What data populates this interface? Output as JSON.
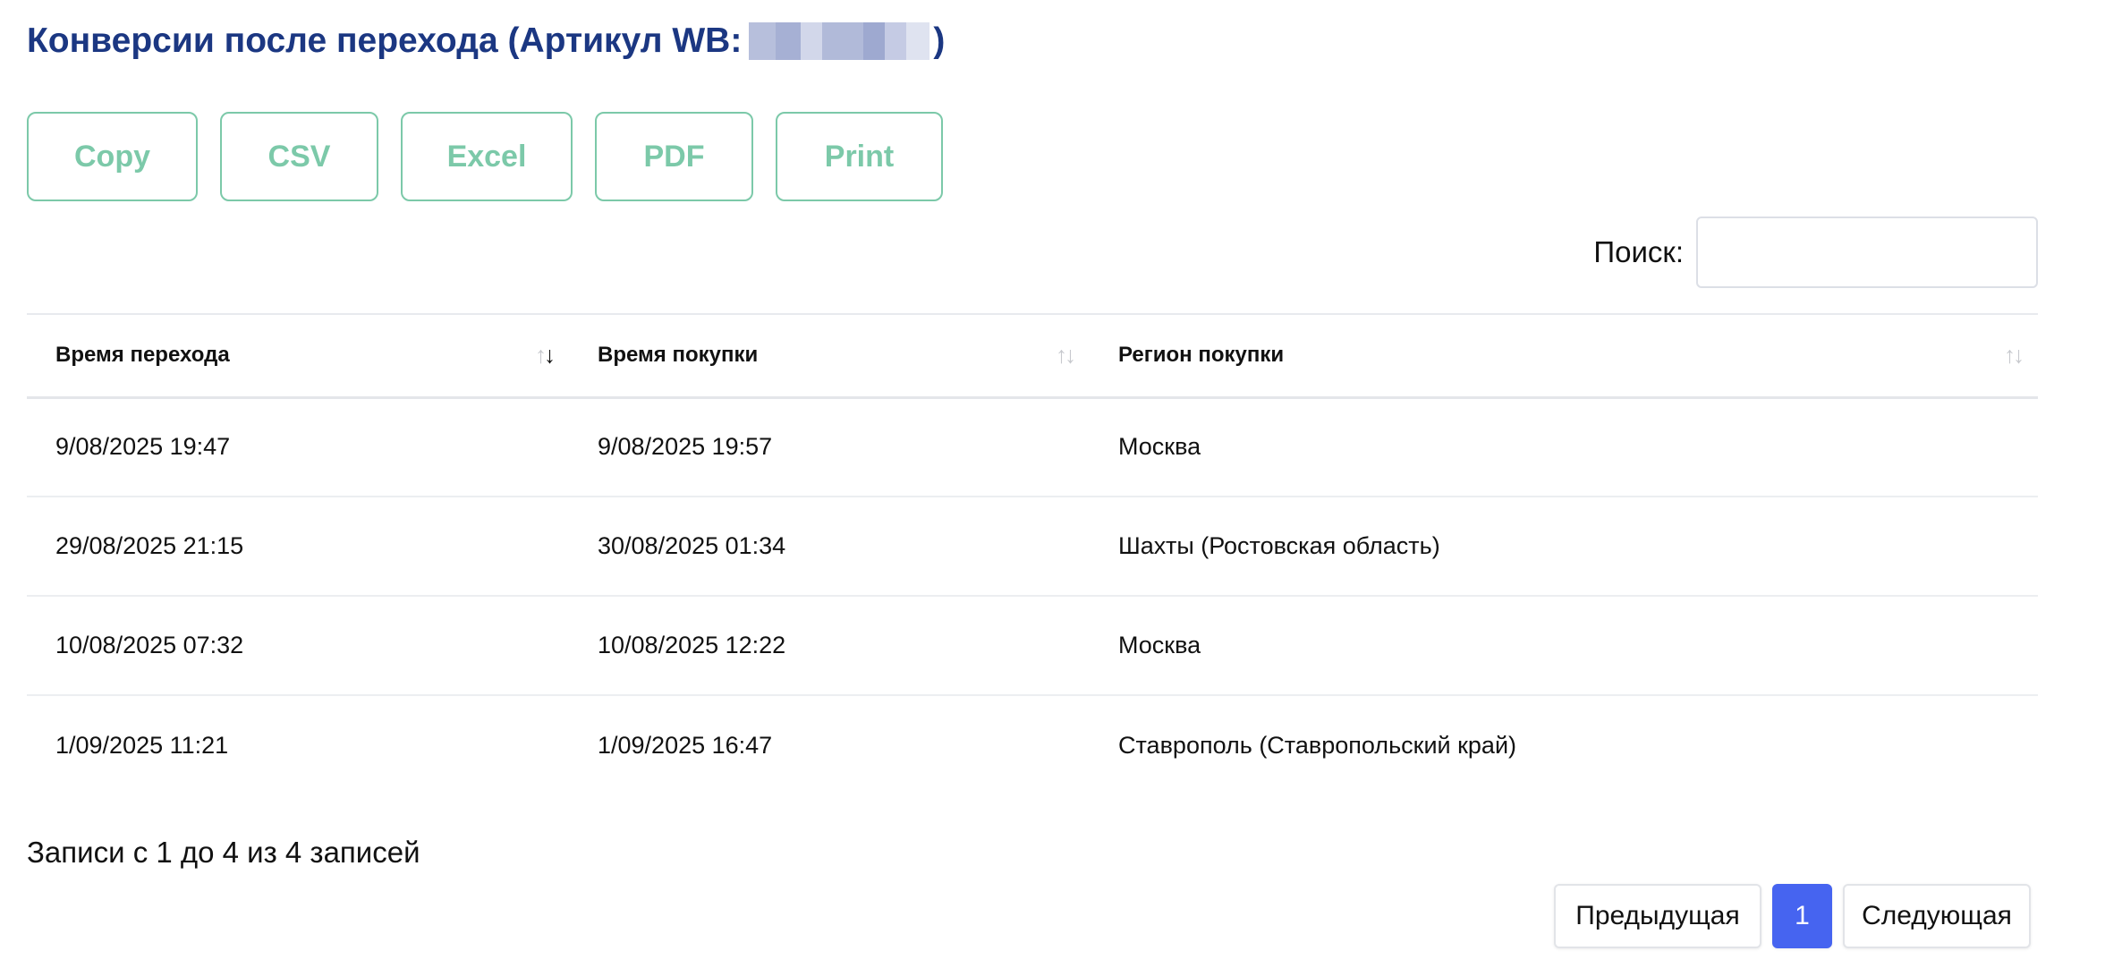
{
  "header": {
    "title_prefix": "Конверсии после перехода (Артикул WB:",
    "title_suffix": ")"
  },
  "export_buttons": {
    "copy": "Copy",
    "csv": "CSV",
    "excel": "Excel",
    "pdf": "PDF",
    "print": "Print"
  },
  "search": {
    "label": "Поиск:",
    "value": ""
  },
  "table": {
    "columns": [
      "Время перехода",
      "Время покупки",
      "Регион покупки"
    ],
    "rows": [
      [
        "9/08/2025 19:47",
        "9/08/2025 19:57",
        "Москва"
      ],
      [
        "29/08/2025 21:15",
        "30/08/2025 01:34",
        "Шахты (Ростовская область)"
      ],
      [
        "10/08/2025 07:32",
        "10/08/2025 12:22",
        "Москва"
      ],
      [
        "1/09/2025 11:21",
        "1/09/2025 16:47",
        "Ставрополь (Ставропольский край)"
      ]
    ]
  },
  "info": {
    "text": "Записи с 1 до 4 из 4 записей"
  },
  "pagination": {
    "previous": "Предыдущая",
    "current_page": "1",
    "next": "Следующая"
  },
  "colors": {
    "title": "#1b3782",
    "export_accent": "#7cc9a9",
    "page_active": "#4664f0"
  }
}
